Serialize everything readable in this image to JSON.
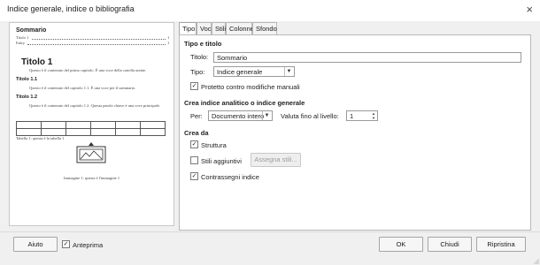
{
  "window": {
    "title": "Indice generale, indice o bibliografia",
    "close_glyph": "×"
  },
  "preview": {
    "toc_heading": "Sommario",
    "toc_entries": [
      {
        "label": "Titolo 1",
        "page": "1"
      },
      {
        "label": "Entry",
        "page": "1"
      }
    ],
    "heading1": "Titolo 1",
    "para1": "Questo è il contenuto del primo capitolo. È una voce della cartella utente.",
    "heading21": "Titolo 1.1",
    "para21": "Questo è il contenuto del capitolo 1.1. È una voce per il sommario.",
    "heading22": "Titolo 1.2",
    "para22": "Questo è il contenuto del capitolo 1.2. Questa parola chiave è una voce principale.",
    "table_caption": "Tabella 1: questa è la tabella 1",
    "image_caption": "Immagine 1: questa è l'immagine 1"
  },
  "tabs": [
    "Tipo",
    "Voci",
    "Stili",
    "Colonne",
    "Sfondo"
  ],
  "type_and_title": {
    "section_label": "Tipo e titolo",
    "title_label": "Titolo:",
    "title_value": "Sommario",
    "type_label": "Tipo:",
    "type_value": "Indice generale",
    "protect_label": "Protetto contro modifiche manuali",
    "protect_checked": "✓"
  },
  "create_index": {
    "section_label": "Crea indice analitico o indice generale",
    "for_label": "Per:",
    "for_value": "Documento intero",
    "level_label": "Valuta fino al livello:",
    "level_value": "1"
  },
  "create_from": {
    "section_label": "Crea da",
    "structure_label": "Struttura",
    "structure_checked": "✓",
    "additional_styles_label": "Stili aggiuntivi",
    "assign_styles_label": "Assegna stili...",
    "index_marks_label": "Contrassegni indice",
    "index_marks_checked": "✓"
  },
  "footer": {
    "help_label": "Aiuto",
    "preview_label": "Anteprima",
    "preview_checked": "✓",
    "ok_label": "OK",
    "close_label": "Chiudi",
    "reset_label": "Ripristina"
  },
  "colors": {
    "dialog_bg": "#f0f0f0",
    "panel_bg": "#ffffff",
    "border": "#b8b8b8",
    "disabled_text": "#9c9c9c"
  }
}
